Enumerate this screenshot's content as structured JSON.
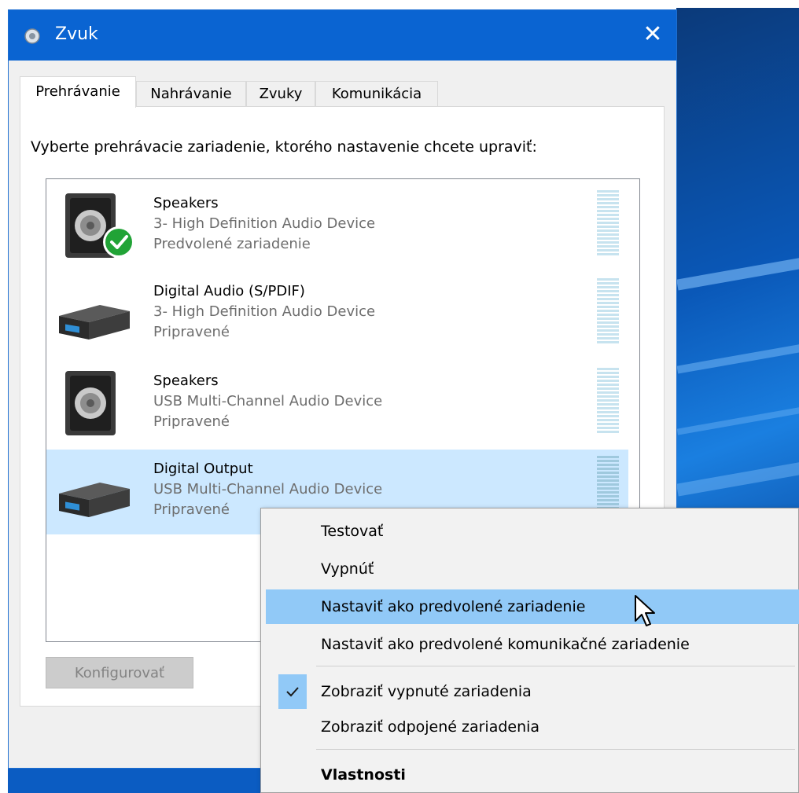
{
  "window": {
    "title": "Zvuk",
    "close_glyph": "✕"
  },
  "tabs": [
    {
      "label": "Prehrávanie",
      "active": true
    },
    {
      "label": "Nahrávanie",
      "active": false
    },
    {
      "label": "Zvuky",
      "active": false
    },
    {
      "label": "Komunikácia",
      "active": false
    }
  ],
  "panel": {
    "instruction": "Vyberte prehrávacie zariadenie, ktorého nastavenie chcete upraviť:",
    "configure_button": "Konfigurovať"
  },
  "devices": [
    {
      "name": "Speakers",
      "description": "3- High Definition Audio Device",
      "status": "Predvolené zariadenie",
      "icon": "speaker-icon",
      "default": true,
      "selected": false
    },
    {
      "name": "Digital Audio (S/PDIF)",
      "description": "3- High Definition Audio Device",
      "status": "Pripravené",
      "icon": "receiver-icon",
      "default": false,
      "selected": false
    },
    {
      "name": "Speakers",
      "description": "USB Multi-Channel Audio Device",
      "status": "Pripravené",
      "icon": "speaker-icon",
      "default": false,
      "selected": false
    },
    {
      "name": "Digital Output",
      "description": "USB Multi-Channel Audio Device",
      "status": "Pripravené",
      "icon": "receiver-icon",
      "default": false,
      "selected": true
    }
  ],
  "context_menu": {
    "items": [
      {
        "label": "Testovať"
      },
      {
        "label": "Vypnúť"
      },
      {
        "label": "Nastaviť ako predvolené zariadenie",
        "highlighted": true
      },
      {
        "label": "Nastaviť ako predvolené komunikačné zariadenie"
      },
      {
        "label": "Zobraziť vypnuté zariadenia",
        "checked": true
      },
      {
        "label": "Zobraziť odpojené zariadenia"
      },
      {
        "label": "Vlastnosti",
        "bold": true
      }
    ]
  },
  "colors": {
    "titlebar": "#0a64d2",
    "selection": "#cce8ff",
    "menu_highlight": "#91c9f7",
    "default_check": "#21a336"
  }
}
